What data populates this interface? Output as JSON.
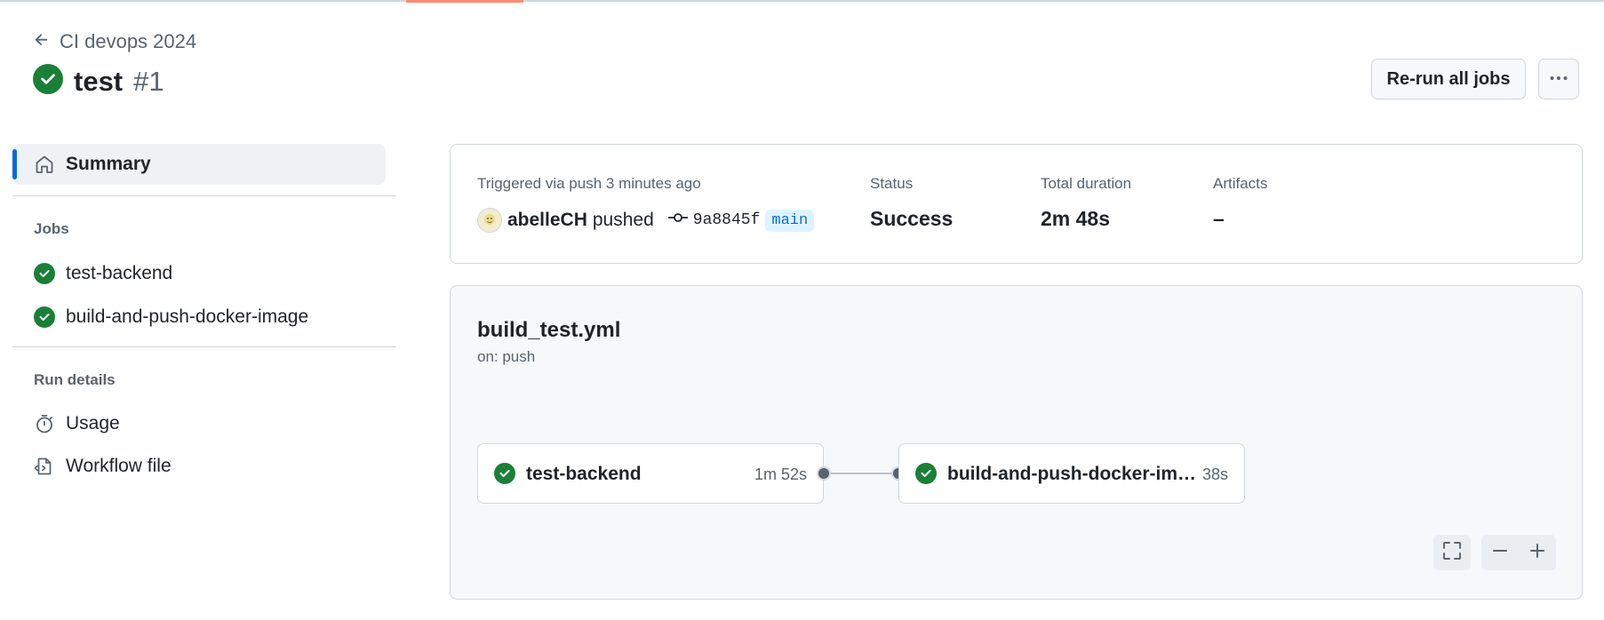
{
  "header": {
    "back_label": "CI devops 2024",
    "run_name": "test",
    "run_number": "#1",
    "rerun_label": "Re-run all jobs"
  },
  "sidebar": {
    "summary_label": "Summary",
    "jobs_heading": "Jobs",
    "jobs": [
      {
        "label": "test-backend",
        "status": "success"
      },
      {
        "label": "build-and-push-docker-image",
        "status": "success"
      }
    ],
    "run_details_heading": "Run details",
    "usage_label": "Usage",
    "workflow_file_label": "Workflow file"
  },
  "summary": {
    "trigger_text": "Triggered via push 3 minutes ago",
    "actor": "abelleCH",
    "action": "pushed",
    "commit": "9a8845f",
    "branch": "main",
    "status_label": "Status",
    "status_value": "Success",
    "duration_label": "Total duration",
    "duration_value": "2m 48s",
    "artifacts_label": "Artifacts",
    "artifacts_value": "–"
  },
  "workflow": {
    "file": "build_test.yml",
    "on": "on: push",
    "jobs": [
      {
        "name": "test-backend",
        "duration": "1m 52s",
        "status": "success"
      },
      {
        "name": "build-and-push-docker-image",
        "duration": "38s",
        "status": "success"
      }
    ]
  },
  "colors": {
    "success": "#1a7f37",
    "accent": "#0969da",
    "tab_underline": "#fd8c73"
  },
  "icons": {
    "back": "arrow-left-icon",
    "status": "check-circle-fill-icon",
    "summary": "home-icon",
    "usage": "stopwatch-icon",
    "workflow_file": "file-code-icon",
    "commit": "git-commit-icon",
    "fullscreen": "screen-full-icon",
    "zoom_out": "dash-icon",
    "zoom_in": "plus-icon"
  }
}
